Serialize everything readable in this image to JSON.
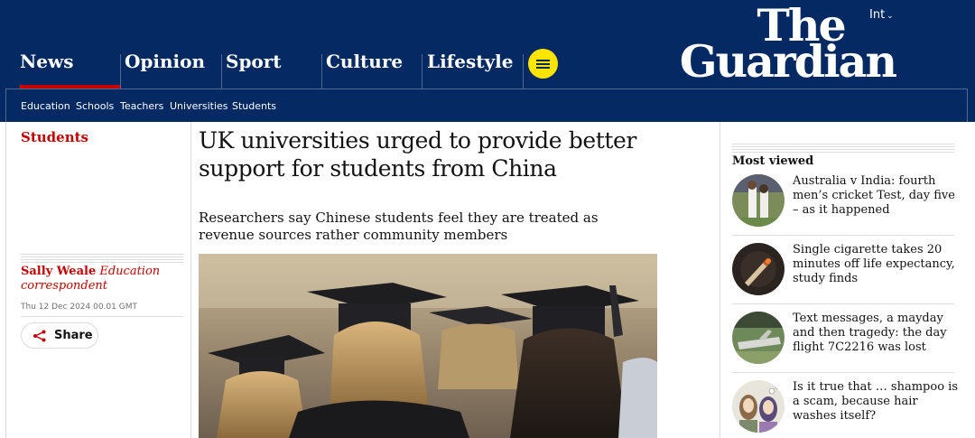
{
  "header": {
    "pillars": [
      "News",
      "Opinion",
      "Sport",
      "Culture",
      "Lifestyle"
    ],
    "edition": "Int",
    "logo_line1": "The",
    "logo_line2": "Guardian",
    "subnav": [
      "Education",
      "Schools",
      "Teachers",
      "Universities",
      "Students"
    ],
    "colors": {
      "brand": "#052962",
      "accent": "#c70000",
      "menu": "#ffe500"
    }
  },
  "article": {
    "section": "Students",
    "headline": "UK universities urged to provide better support for students from China",
    "standfirst": "Researchers say Chinese students feel they are treated as revenue sources rather community members",
    "author": "Sally Weale",
    "author_role": "Education correspondent",
    "date": "Thu 12 Dec 2024 00.01 GMT",
    "share_label": "Share"
  },
  "most_viewed": {
    "title": "Most viewed",
    "items": [
      {
        "text": "Australia v India: fourth men’s cricket Test, day five – as it happened"
      },
      {
        "text": "Single cigarette takes 20 minutes off life expectancy, study finds"
      },
      {
        "text": "Text messages, a mayday and then tragedy: the day flight 7C2216 was lost"
      },
      {
        "text": "Is it true that … shampoo is a scam, because hair washes itself?"
      }
    ]
  }
}
